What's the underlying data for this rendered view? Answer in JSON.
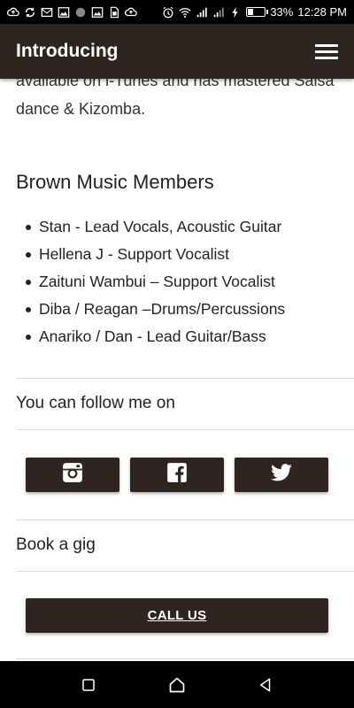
{
  "status_bar": {
    "battery_percent": "33%",
    "time": "12:28 PM",
    "battery_level": 0.33,
    "left_icons": [
      "cloud-upload-icon",
      "sync-icon",
      "mail-icon",
      "image-icon",
      "circle-icon",
      "image-icon",
      "sim-icon",
      "cloud-upload-icon"
    ],
    "right_icons": [
      "alarm-icon",
      "wifi-icon",
      "signal-icon",
      "signal-icon",
      "charging-icon",
      "battery-icon"
    ]
  },
  "app_bar": {
    "title": "Introducing",
    "menu_icon": "hamburger-menu-icon",
    "background": "#2f2520"
  },
  "intro": {
    "text": "available on i-Tunes and has mastered Salsa dance & Kizomba."
  },
  "members_section": {
    "title": "Brown Music Members",
    "members": [
      "Stan - Lead Vocals, Acoustic Guitar",
      "Hellena J - Support Vocalist",
      "Zaituni Wambui – Support Vocalist",
      "Diba / Reagan –Drums/Percussions",
      "Anariko / Dan - Lead Guitar/Bass"
    ]
  },
  "follow_section": {
    "title": "You can follow me on",
    "buttons": [
      {
        "icon": "instagram-icon"
      },
      {
        "icon": "facebook-icon"
      },
      {
        "icon": "twitter-icon"
      }
    ]
  },
  "gig_section": {
    "title": "Book a gig",
    "call_label": "CALL US"
  },
  "nav_bar": {
    "buttons": [
      "recents-square-icon",
      "home-icon",
      "back-triangle-icon"
    ]
  }
}
